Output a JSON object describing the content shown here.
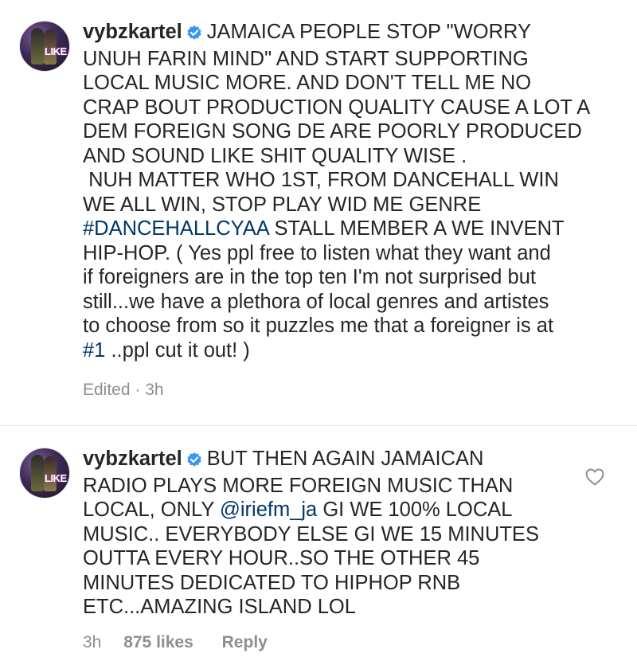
{
  "comments": [
    {
      "username": "vybzkartel",
      "avatar_text": "LIKE",
      "lines": [
        "JAMAICA PEOPLE STOP \"WORRY",
        "UNUH FARIN MIND\" AND START SUPPORTING",
        "LOCAL MUSIC MORE. AND DON'T TELL ME NO",
        "CRAP BOUT PRODUCTION QUALITY CAUSE A LOT A",
        "DEM FOREIGN SONG DE ARE POORLY PRODUCED",
        "AND SOUND LIKE SHIT QUALITY WISE .",
        " NUH MATTER WHO 1ST, FROM DANCEHALL WIN",
        "WE ALL WIN, STOP PLAY WID ME GENRE",
        "STALL MEMBER A WE INVENT",
        "HIP-HOP. ( Yes ppl free to listen what they want and",
        "if foreigners are in the top ten I'm not surprised but",
        "still...we have a plethora of local genres and artistes",
        "to choose from so it puzzles me that a foreigner is at",
        "..ppl cut it out! )"
      ],
      "hashtag_1": "#DANCEHALLCYAA",
      "hashtag_2": "#1",
      "meta": "Edited · 3h"
    },
    {
      "username": "vybzkartel",
      "avatar_text": "LIKE",
      "lines": [
        "BUT THEN AGAIN JAMAICAN",
        "RADIO PLAYS MORE FOREIGN MUSIC THAN",
        "LOCAL, ONLY",
        "GI WE 100% LOCAL",
        "MUSIC.. EVERYBODY ELSE GI WE 15 MINUTES",
        "OUTTA EVERY HOUR..SO THE OTHER 45",
        "MINUTES DEDICATED TO HIPHOP RNB",
        "ETC...AMAZING ISLAND LOL"
      ],
      "mention": "@iriefm_ja",
      "time": "3h",
      "likes": "875 likes",
      "reply": "Reply",
      "like_icon": "heart-outline-icon"
    }
  ],
  "colors": {
    "text": "#262626",
    "link": "#00376b",
    "meta": "#8e8e8e",
    "verified": "#3897f0"
  }
}
